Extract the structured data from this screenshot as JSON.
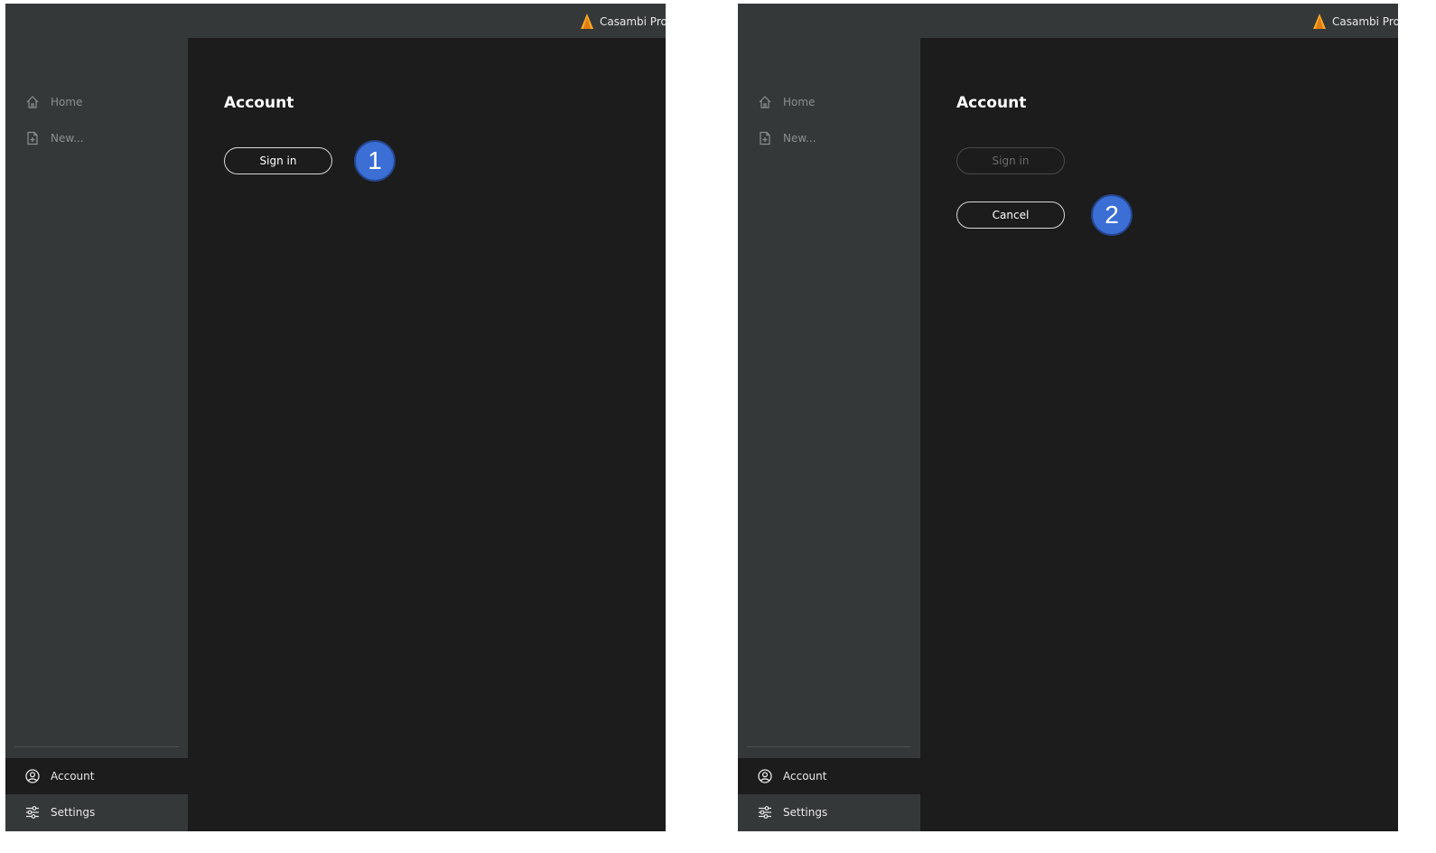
{
  "colors": {
    "accent_badge": "#3b6fd6",
    "logo_orange": "#f5a623",
    "sidebar_bg": "#353839",
    "content_bg": "#1c1c1c"
  },
  "panels": [
    {
      "app_title": "Casambi Pro (",
      "nav_top": [
        {
          "label": "Home",
          "icon": "home-icon"
        },
        {
          "label": "New...",
          "icon": "new-file-icon"
        }
      ],
      "nav_bottom": [
        {
          "label": "Account",
          "icon": "account-icon",
          "selected": true
        },
        {
          "label": "Settings",
          "icon": "settings-sliders-icon",
          "selected": false
        }
      ],
      "page_title": "Account",
      "sign_in_label": "Sign in",
      "step_badge": "1"
    },
    {
      "app_title": "Casambi Pro (",
      "nav_top": [
        {
          "label": "Home",
          "icon": "home-icon"
        },
        {
          "label": "New...",
          "icon": "new-file-icon"
        }
      ],
      "nav_bottom": [
        {
          "label": "Account",
          "icon": "account-icon",
          "selected": true
        },
        {
          "label": "Settings",
          "icon": "settings-sliders-icon",
          "selected": false
        }
      ],
      "page_title": "Account",
      "sign_in_label": "Sign in",
      "sign_in_disabled": true,
      "cancel_label": "Cancel",
      "step_badge": "2"
    }
  ]
}
